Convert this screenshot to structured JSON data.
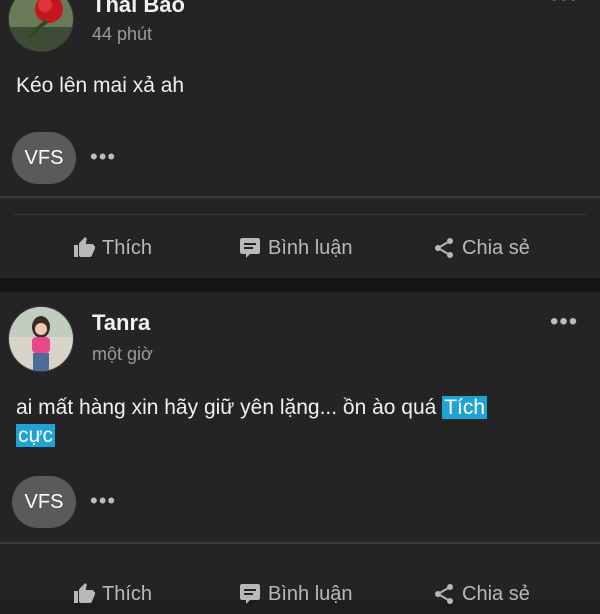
{
  "posts": [
    {
      "author": "Thái Bảo",
      "time": "44 phút",
      "content": "Kéo lên mai xả ah",
      "reaction_badge": "VFS"
    },
    {
      "author": "Tanra",
      "time": "một giờ",
      "content": "ai mất hàng xin hãy giữ yên lặng... ồn ào quá",
      "tag_part1": "Tích",
      "tag_part2": "cực",
      "reaction_badge": "VFS"
    }
  ],
  "actions": {
    "like": "Thích",
    "comment": "Bình luận",
    "share": "Chia sẻ"
  },
  "colors": {
    "background": "#1e1e1e",
    "card": "#242424",
    "tag_highlight": "#1fa3d6"
  },
  "icons": [
    "thumbs-up-icon",
    "comment-icon",
    "share-icon",
    "more-icon",
    "avatar-rose",
    "avatar-person"
  ]
}
